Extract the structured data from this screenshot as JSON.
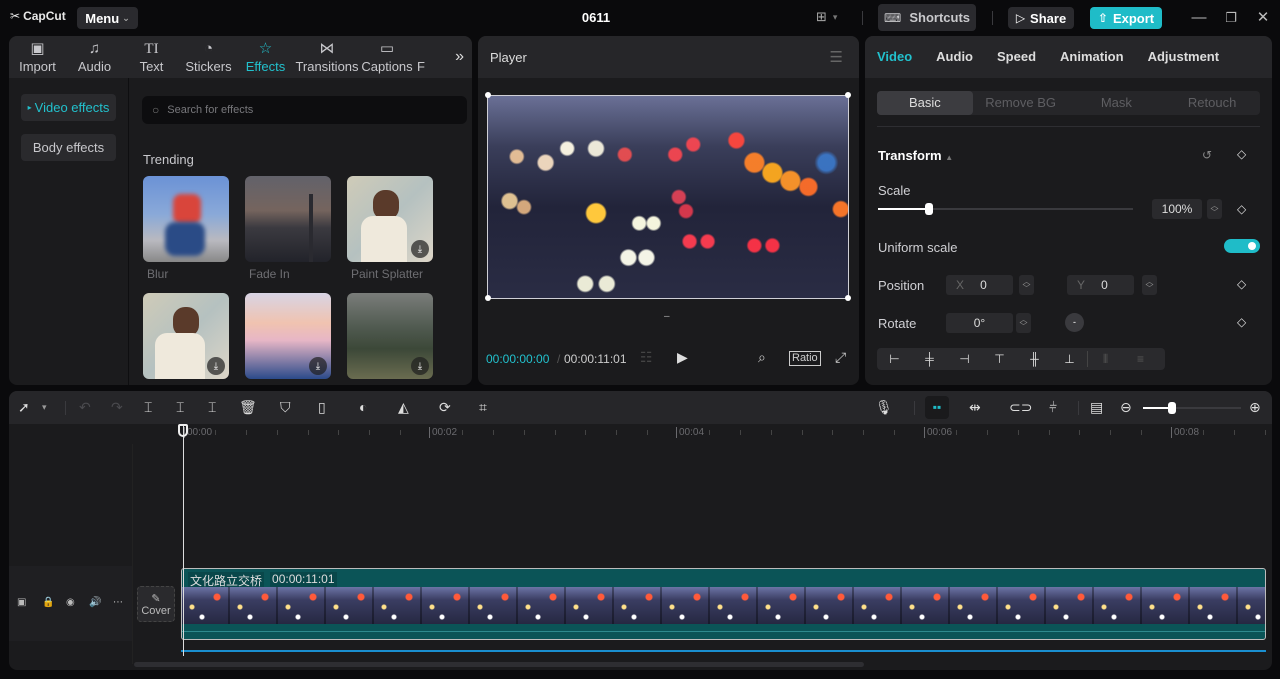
{
  "app": {
    "logo": "CapCut",
    "menu_label": "Menu",
    "project_title": "0611",
    "shortcuts_label": "Shortcuts",
    "share_label": "Share",
    "export_label": "Export",
    "accent_color": "#1fbcc8"
  },
  "media": {
    "tabs": [
      {
        "label": "Import",
        "icon": "import-icon"
      },
      {
        "label": "Audio",
        "icon": "audio-icon"
      },
      {
        "label": "Text",
        "icon": "text-icon"
      },
      {
        "label": "Stickers",
        "icon": "sticker-icon"
      },
      {
        "label": "Effects",
        "icon": "effects-icon",
        "active": true
      },
      {
        "label": "Transitions",
        "icon": "transitions-icon"
      },
      {
        "label": "Captions",
        "icon": "captions-icon"
      },
      {
        "label": "F",
        "icon": "filters-icon"
      }
    ],
    "sidebar": [
      {
        "label": "Video effects",
        "active": true
      },
      {
        "label": "Body effects"
      }
    ],
    "search_placeholder": "Search for effects",
    "section_title": "Trending",
    "effects": [
      {
        "label": "Blur",
        "download": false
      },
      {
        "label": "Fade In",
        "download": false
      },
      {
        "label": "Paint Splatter",
        "download": true
      },
      {
        "label": "",
        "download": true
      },
      {
        "label": "",
        "download": true
      },
      {
        "label": "",
        "download": true
      }
    ]
  },
  "player": {
    "title": "Player",
    "current_time": "00:00:00:00",
    "total_time": "00:00:11:01",
    "ratio_label": "Ratio"
  },
  "properties": {
    "tabs": [
      "Video",
      "Audio",
      "Speed",
      "Animation",
      "Adjustment"
    ],
    "active_tab": "Video",
    "subtabs": [
      "Basic",
      "Remove BG",
      "Mask",
      "Retouch"
    ],
    "active_subtab": "Basic",
    "transform_label": "Transform",
    "scale_label": "Scale",
    "scale_value": "100%",
    "scale_slider_fraction": 0.2,
    "uniform_scale_label": "Uniform scale",
    "uniform_scale_on": true,
    "position_label": "Position",
    "position_x_label": "X",
    "position_x": "0",
    "position_y_label": "Y",
    "position_y": "0",
    "rotate_label": "Rotate",
    "rotate_value": "0°"
  },
  "timeline": {
    "ruler_labels": [
      "00:00",
      "00:02",
      "00:04",
      "00:06",
      "00:08"
    ],
    "clip_name": "文化路立交桥",
    "clip_duration": "00:00:11:01",
    "cover_label": "Cover",
    "zoom_fraction": 0.3
  }
}
